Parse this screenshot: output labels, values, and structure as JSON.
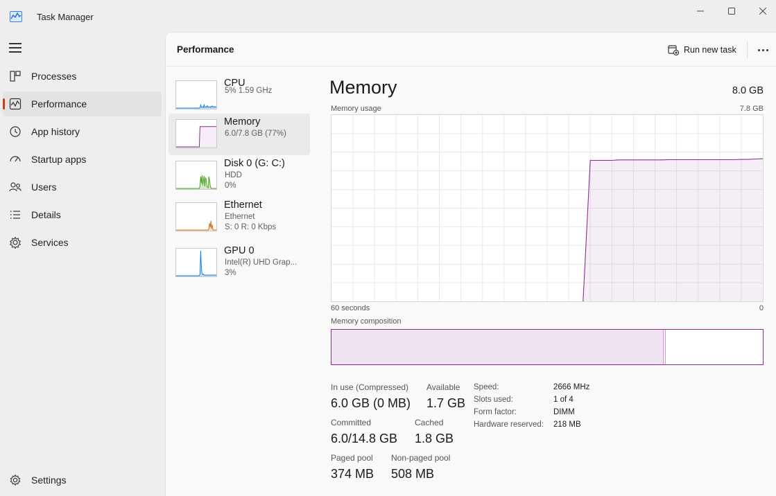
{
  "window": {
    "title": "Task Manager",
    "controls": [
      "minimize",
      "maximize",
      "close"
    ]
  },
  "sidebar": {
    "menu_icon": "hamburger-menu-icon",
    "items": [
      {
        "label": "Processes",
        "icon": "processes-icon",
        "active": false
      },
      {
        "label": "Performance",
        "icon": "performance-icon",
        "active": true
      },
      {
        "label": "App history",
        "icon": "app-history-icon",
        "active": false
      },
      {
        "label": "Startup apps",
        "icon": "startup-apps-icon",
        "active": false
      },
      {
        "label": "Users",
        "icon": "users-icon",
        "active": false
      },
      {
        "label": "Details",
        "icon": "details-icon",
        "active": false
      },
      {
        "label": "Services",
        "icon": "services-icon",
        "active": false
      }
    ],
    "settings": {
      "label": "Settings",
      "icon": "gear-icon"
    }
  },
  "header": {
    "title": "Performance",
    "run_new_task": "Run new task",
    "more_icon": "more-options-icon"
  },
  "resources": [
    {
      "name": "CPU",
      "sub1": "5%  1.59 GHz",
      "sub2": "",
      "active": false,
      "graph_color": "#1a7fd4",
      "graph": [
        0,
        0,
        0,
        0,
        0,
        0,
        0,
        0,
        0,
        0,
        0,
        0,
        0,
        0,
        0,
        0,
        0,
        0,
        0,
        0,
        0,
        0,
        0,
        0,
        0,
        0,
        0,
        0,
        0,
        0,
        0,
        0,
        0,
        0,
        0,
        2,
        12,
        4,
        3,
        5,
        2,
        14,
        3,
        4,
        6,
        3,
        9,
        4,
        3,
        5,
        3,
        6,
        4,
        8,
        4,
        5,
        3,
        6,
        4,
        5
      ]
    },
    {
      "name": "Memory",
      "sub1": "6.0/7.8 GB (77%)",
      "sub2": "",
      "active": true,
      "graph_color": "#8b2c94",
      "graph": [
        0,
        0,
        0,
        0,
        0,
        0,
        0,
        0,
        0,
        0,
        0,
        0,
        0,
        0,
        0,
        0,
        0,
        0,
        0,
        0,
        0,
        0,
        0,
        0,
        0,
        0,
        0,
        0,
        0,
        0,
        0,
        0,
        0,
        0,
        0,
        77,
        77,
        77,
        77,
        77,
        77,
        77,
        77,
        77,
        77,
        77,
        77,
        77,
        77,
        77,
        77,
        77,
        77,
        77,
        77,
        77,
        77,
        77,
        77,
        78
      ]
    },
    {
      "name": "Disk 0 (G: C:)",
      "sub1": "HDD",
      "sub2": "0%",
      "active": false,
      "graph_color": "#4ca320",
      "graph": [
        0,
        0,
        0,
        0,
        0,
        0,
        0,
        0,
        0,
        0,
        0,
        0,
        0,
        0,
        0,
        0,
        0,
        0,
        0,
        0,
        0,
        0,
        0,
        0,
        0,
        0,
        0,
        0,
        0,
        0,
        0,
        0,
        0,
        0,
        0,
        10,
        45,
        20,
        50,
        12,
        30,
        48,
        8,
        40,
        35,
        10,
        5,
        2,
        45,
        30,
        10,
        2,
        0,
        0,
        0,
        0,
        0,
        0,
        0,
        0
      ]
    },
    {
      "name": "Ethernet",
      "sub1": "Ethernet",
      "sub2": "S: 0 R: 0 Kbps",
      "active": false,
      "graph_color": "#d9721c",
      "graph": [
        0,
        0,
        0,
        0,
        0,
        0,
        0,
        0,
        0,
        0,
        0,
        0,
        0,
        0,
        0,
        0,
        0,
        0,
        0,
        0,
        0,
        0,
        0,
        0,
        0,
        0,
        0,
        0,
        0,
        0,
        0,
        0,
        0,
        0,
        0,
        0,
        0,
        0,
        0,
        0,
        0,
        0,
        0,
        0,
        0,
        0,
        0,
        0,
        5,
        25,
        10,
        35,
        5,
        20,
        0,
        0,
        0,
        0,
        0,
        0
      ]
    },
    {
      "name": "GPU 0",
      "sub1": "Intel(R) UHD Grap...",
      "sub2": "3%",
      "active": false,
      "graph_color": "#1a7fd4",
      "graph": [
        0,
        0,
        0,
        0,
        0,
        0,
        0,
        0,
        0,
        0,
        0,
        0,
        0,
        0,
        0,
        0,
        0,
        0,
        0,
        0,
        0,
        0,
        0,
        0,
        0,
        0,
        0,
        0,
        0,
        0,
        0,
        0,
        0,
        0,
        0,
        5,
        95,
        30,
        8,
        4,
        6,
        3,
        2,
        3,
        2,
        2,
        3,
        2,
        3,
        2,
        2,
        3,
        2,
        3,
        2,
        2,
        3,
        2,
        3,
        2
      ]
    }
  ],
  "detail": {
    "title": "Memory",
    "total": "8.0 GB",
    "usage_label": "Memory usage",
    "usage_max": "7.8 GB",
    "time_left": "60 seconds",
    "time_right": "0",
    "composition_label": "Memory composition",
    "accent_color": "#8b2c94",
    "fill_color": "#f3eef4"
  },
  "chart_data": {
    "type": "area",
    "title": "Memory usage",
    "xlabel": "",
    "ylabel": "",
    "x": [
      60,
      59,
      58,
      57,
      56,
      55,
      54,
      53,
      52,
      51,
      50,
      49,
      48,
      47,
      46,
      45,
      44,
      43,
      42,
      41,
      40,
      39,
      38,
      37,
      36,
      35,
      34,
      33,
      32,
      31,
      30,
      29,
      28,
      27,
      26,
      25,
      24,
      23,
      22,
      21,
      20,
      19,
      18,
      17,
      16,
      15,
      14,
      13,
      12,
      11,
      10,
      9,
      8,
      7,
      6,
      5,
      4,
      3,
      2,
      1,
      0
    ],
    "series": [
      {
        "values": [
          null,
          null,
          null,
          null,
          null,
          null,
          null,
          null,
          null,
          null,
          null,
          null,
          null,
          null,
          null,
          null,
          null,
          null,
          null,
          null,
          null,
          null,
          null,
          null,
          null,
          null,
          null,
          null,
          null,
          null,
          null,
          null,
          null,
          null,
          null,
          0,
          5.9,
          5.9,
          5.9,
          5.9,
          5.92,
          5.92,
          5.92,
          5.92,
          5.92,
          5.92,
          5.92,
          5.93,
          5.93,
          5.93,
          5.93,
          5.93,
          5.93,
          5.93,
          5.93,
          5.93,
          5.93,
          5.94,
          5.94,
          5.96,
          5.97
        ]
      }
    ],
    "ylim": [
      0,
      7.8
    ],
    "xlim": [
      60,
      0
    ],
    "grid": true
  },
  "composition": {
    "total_gb": 7.8,
    "in_use_gb": 6.0,
    "modified_gb": 0.05
  },
  "stats": {
    "in_use_label": "In use (Compressed)",
    "in_use_value": "6.0 GB (0 MB)",
    "available_label": "Available",
    "available_value": "1.7 GB",
    "committed_label": "Committed",
    "committed_value": "6.0/14.8 GB",
    "cached_label": "Cached",
    "cached_value": "1.8 GB",
    "paged_label": "Paged pool",
    "paged_value": "374 MB",
    "nonpaged_label": "Non-paged pool",
    "nonpaged_value": "508 MB"
  },
  "specs": [
    {
      "key": "Speed:",
      "value": "2666 MHz"
    },
    {
      "key": "Slots used:",
      "value": "1 of 4"
    },
    {
      "key": "Form factor:",
      "value": "DIMM"
    },
    {
      "key": "Hardware reserved:",
      "value": "218 MB"
    }
  ]
}
